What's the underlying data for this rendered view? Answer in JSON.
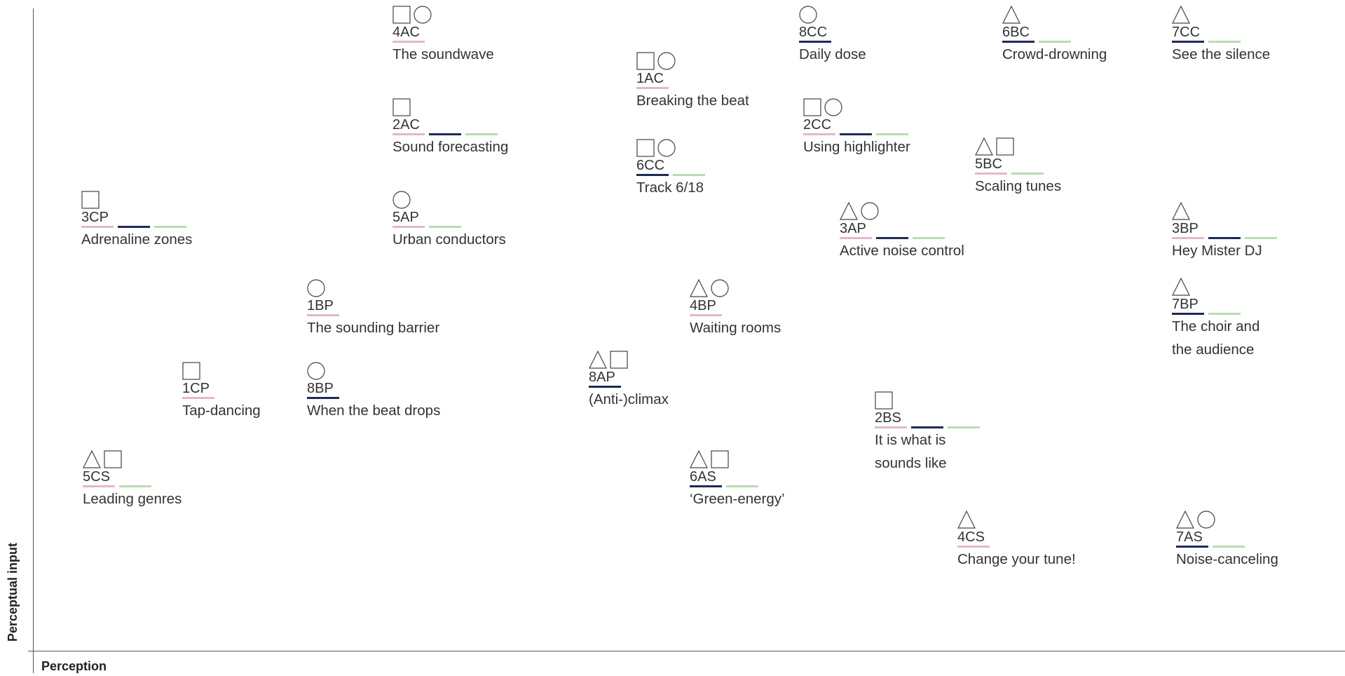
{
  "axes": {
    "y_label": "Perceptual input",
    "x_label": "Perception"
  },
  "colors": {
    "pink": "#e2b8c8",
    "navy": "#1f2a55",
    "green": "#b8ddb0"
  },
  "items": [
    {
      "code": "4AC",
      "title": "The soundwave",
      "shapes": [
        "square",
        "circle"
      ],
      "bars": [
        "pink"
      ]
    },
    {
      "code": "8CC",
      "title": "Daily dose",
      "shapes": [
        "circle"
      ],
      "bars": [
        "navy"
      ]
    },
    {
      "code": "6BC",
      "title": "Crowd-drowning",
      "shapes": [
        "triangle"
      ],
      "bars": [
        "navy",
        "green"
      ]
    },
    {
      "code": "7CC",
      "title": "See the silence",
      "shapes": [
        "triangle"
      ],
      "bars": [
        "navy",
        "green"
      ]
    },
    {
      "code": "1AC",
      "title": "Breaking the beat",
      "shapes": [
        "square",
        "circle"
      ],
      "bars": [
        "pink"
      ]
    },
    {
      "code": "2AC",
      "title": "Sound forecasting",
      "shapes": [
        "square"
      ],
      "bars": [
        "pink",
        "navy",
        "green"
      ]
    },
    {
      "code": "2CC",
      "title": "Using highlighter",
      "shapes": [
        "square",
        "circle"
      ],
      "bars": [
        "pink",
        "navy",
        "green"
      ]
    },
    {
      "code": "5BC",
      "title": "Scaling tunes",
      "shapes": [
        "triangle",
        "square"
      ],
      "bars": [
        "pink",
        "green"
      ]
    },
    {
      "code": "6CC",
      "title": "Track 6/18",
      "shapes": [
        "square",
        "circle"
      ],
      "bars": [
        "navy",
        "green"
      ]
    },
    {
      "code": "3CP",
      "title": "Adrenaline zones",
      "shapes": [
        "square"
      ],
      "bars": [
        "pink",
        "navy",
        "green"
      ]
    },
    {
      "code": "5AP",
      "title": "Urban conductors",
      "shapes": [
        "circle"
      ],
      "bars": [
        "pink",
        "green"
      ]
    },
    {
      "code": "3AP",
      "title": "Active noise control",
      "shapes": [
        "triangle",
        "circle"
      ],
      "bars": [
        "pink",
        "navy",
        "green"
      ]
    },
    {
      "code": "3BP",
      "title": "Hey Mister DJ",
      "shapes": [
        "triangle"
      ],
      "bars": [
        "pink",
        "navy",
        "green"
      ]
    },
    {
      "code": "1BP",
      "title": "The sounding barrier",
      "shapes": [
        "circle"
      ],
      "bars": [
        "pink"
      ]
    },
    {
      "code": "4BP",
      "title": "Waiting rooms",
      "shapes": [
        "triangle",
        "circle"
      ],
      "bars": [
        "pink"
      ]
    },
    {
      "code": "7BP",
      "title": "The choir and",
      "title2": "the audience",
      "shapes": [
        "triangle"
      ],
      "bars": [
        "navy",
        "green"
      ]
    },
    {
      "code": "8AP",
      "title": "(Anti-)climax",
      "shapes": [
        "triangle",
        "square"
      ],
      "bars": [
        "navy"
      ]
    },
    {
      "code": "1CP",
      "title": "Tap-dancing",
      "shapes": [
        "square"
      ],
      "bars": [
        "pink"
      ]
    },
    {
      "code": "8BP",
      "title": "When the beat drops",
      "shapes": [
        "circle"
      ],
      "bars": [
        "navy"
      ]
    },
    {
      "code": "2BS",
      "title": "It is what is",
      "title2": "sounds like",
      "shapes": [
        "square"
      ],
      "bars": [
        "pink",
        "navy",
        "green"
      ]
    },
    {
      "code": "5CS",
      "title": "Leading genres",
      "shapes": [
        "triangle",
        "square"
      ],
      "bars": [
        "pink",
        "green"
      ]
    },
    {
      "code": "6AS",
      "title": "‘Green-energy’",
      "shapes": [
        "triangle",
        "square"
      ],
      "bars": [
        "navy",
        "green"
      ]
    },
    {
      "code": "4CS",
      "title": "Change your tune!",
      "shapes": [
        "triangle"
      ],
      "bars": [
        "pink"
      ]
    },
    {
      "code": "7AS",
      "title": "Noise-canceling",
      "shapes": [
        "triangle",
        "circle"
      ],
      "bars": [
        "navy",
        "green"
      ]
    }
  ]
}
